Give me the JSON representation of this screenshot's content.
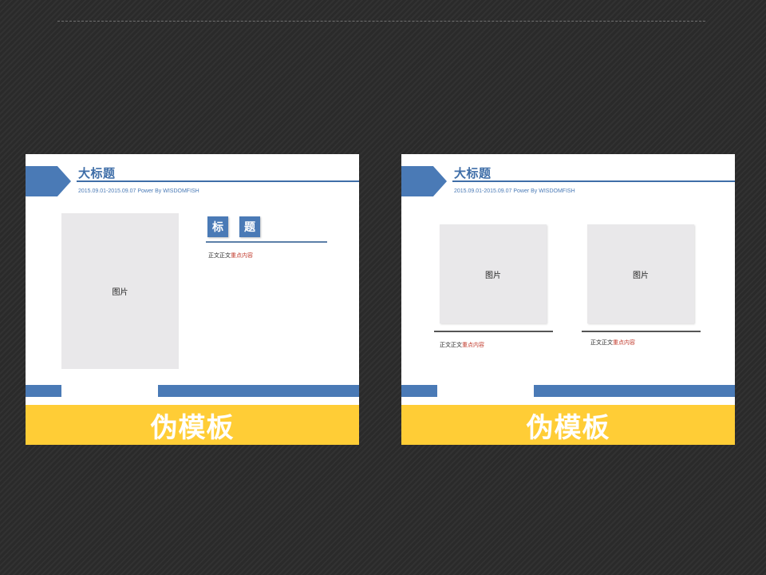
{
  "slides": [
    {
      "title": "大标题",
      "subtitle": "2015.09.01-2015.09.07 Power By WISDOMFISH",
      "image_label": "图片",
      "heading_chars": [
        "标",
        "题"
      ],
      "body_plain": "正文正文",
      "body_highlight": "重点内容",
      "banner": "伪模板"
    },
    {
      "title": "大标题",
      "subtitle": "2015.09.01-2015.09.07 Power By WISDOMFISH",
      "image_labels": [
        "图片",
        "图片"
      ],
      "captions": [
        {
          "plain": "正文正文",
          "highlight": "重点内容"
        },
        {
          "plain": "正文正文",
          "highlight": "重点内容"
        }
      ],
      "banner": "伪模板"
    }
  ],
  "colors": {
    "accent_blue": "#4a7ab6",
    "banner_yellow": "#ffcd36",
    "highlight_red": "#c0392b",
    "placeholder_gray": "#e9e8ea"
  }
}
